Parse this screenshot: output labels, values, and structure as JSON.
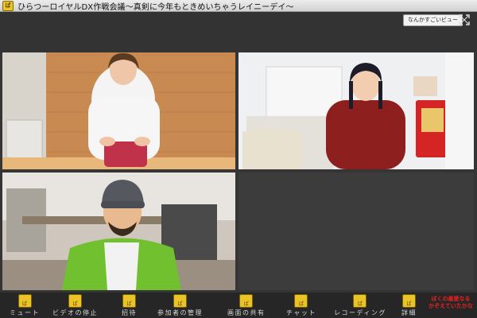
{
  "window": {
    "title": "ひらつーロイヤルDX作戦会議〜真剣に今年もときめいちゃうレイニーデイ〜",
    "app_icon_glyph": "ぱ"
  },
  "topbar": {
    "view_button_label": "なんかすごいビュー",
    "fullscreen_icon": "fullscreen-icon"
  },
  "toolbar": {
    "items": [
      {
        "label": "ミュート",
        "icon": "mic-icon"
      },
      {
        "label": "ビデオの停止",
        "icon": "camera-icon"
      },
      {
        "label": "招待",
        "icon": "invite-icon"
      },
      {
        "label": "参加者の管理",
        "icon": "participants-icon"
      },
      {
        "label": "画面の共有",
        "icon": "share-icon"
      },
      {
        "label": "チャット",
        "icon": "chat-icon"
      },
      {
        "label": "レコーディング",
        "icon": "record-icon"
      },
      {
        "label": "詳細",
        "icon": "more-icon"
      }
    ],
    "badge_line1": "ぼくの最愛なる",
    "badge_line2": "かぞえていたかな",
    "icon_glyph": "ぱ"
  },
  "colors": {
    "toolbar_icon": "#e9c327",
    "badge_text": "#e82020",
    "background": "#353535"
  }
}
